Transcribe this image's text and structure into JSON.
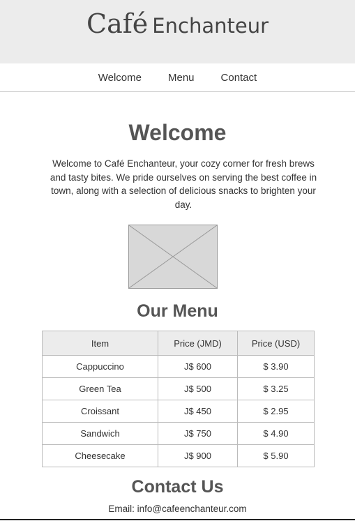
{
  "header": {
    "brand_script": "Café",
    "brand_word": "Enchanteur"
  },
  "nav": {
    "items": [
      "Welcome",
      "Menu",
      "Contact"
    ]
  },
  "welcome": {
    "title": "Welcome",
    "text": "Welcome to Café Enchanteur, your cozy corner for fresh brews and tasty bites. We pride ourselves on serving the best coffee in town, along with a selection of delicious snacks to brighten your day."
  },
  "menu": {
    "title": "Our Menu",
    "columns": [
      "Item",
      "Price (JMD)",
      "Price (USD)"
    ],
    "rows": [
      [
        "Cappuccino",
        "J$ 600",
        "$ 3.90"
      ],
      [
        "Green Tea",
        "J$ 500",
        "$ 3.25"
      ],
      [
        "Croissant",
        "J$ 450",
        "$ 2.95"
      ],
      [
        "Sandwich",
        "J$ 750",
        "$ 4.90"
      ],
      [
        "Cheesecake",
        "J$ 900",
        "$ 5.90"
      ]
    ]
  },
  "contact": {
    "title": "Contact Us",
    "label": "Email:",
    "email": "info@cafeenchanteur.com"
  },
  "colors": {
    "header_bg": "#ececec",
    "heading": "#555555",
    "placeholder": "#d8d8d8"
  },
  "icons": {
    "hero_image": "image-placeholder-icon"
  }
}
